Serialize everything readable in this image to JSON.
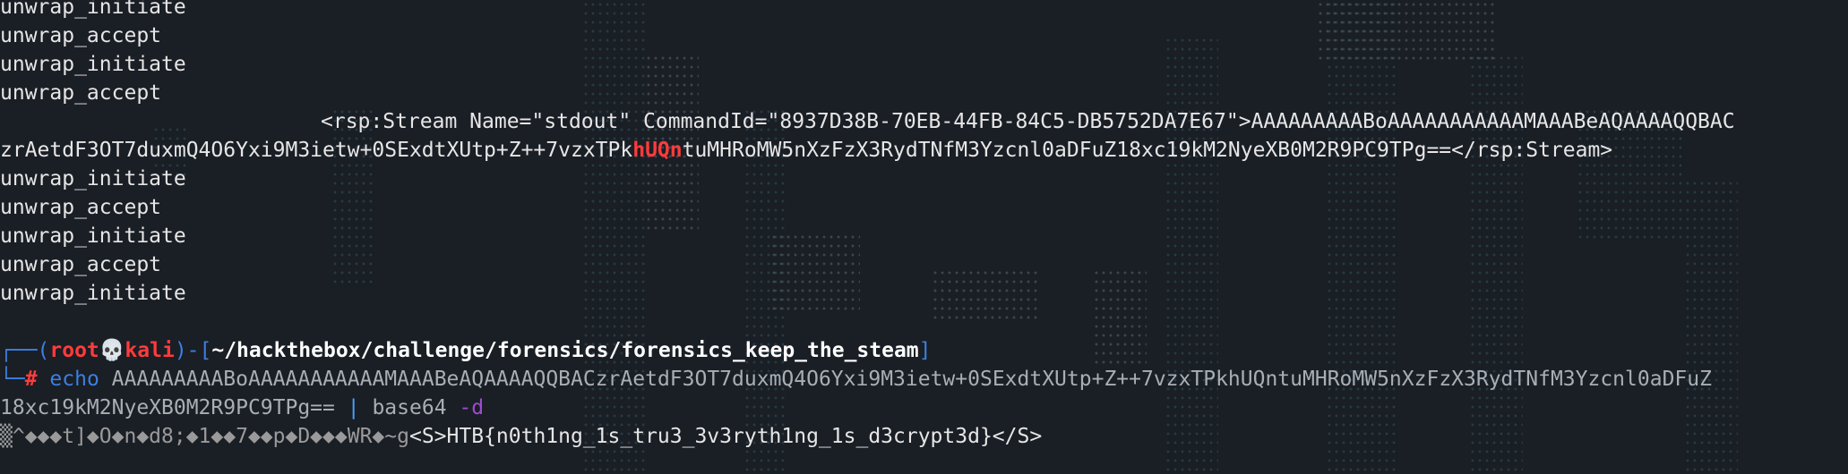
{
  "log_lines": {
    "l0": "unwrap_initiate",
    "l1": "unwrap_accept",
    "l2": "unwrap_initiate",
    "l3": "unwrap_accept",
    "stream_open": "<rsp:Stream Name=\"stdout\" CommandId=\"8937D38B-70EB-44FB-84C5-DB5752DA7E67\">AAAAAAAAABoAAAAAAAAAAAMAAABeAQAAAAQQBAC",
    "stream_cont_a": "zrAetdF3OT7duxmQ4O6Yxi9M3ietw+0SExdtXUtp+Z++7vzxTPk",
    "stream_highlight": "hUQn",
    "stream_cont_b": "tuMHRoMW5nXzFzX3RydTNfM3Yzcnl0aDFuZ18xc19kM2NyeXB0M2R9PC9TPg==</rsp:Stream>",
    "l6": "unwrap_initiate",
    "l7": "unwrap_accept",
    "l8": "unwrap_initiate",
    "l9": "unwrap_accept",
    "l10": "unwrap_initiate"
  },
  "prompt": {
    "box_top": "┌──(",
    "user": "root",
    "skull": "💀",
    "host": "kali",
    "mid": ")-[",
    "cwd": "~/hackthebox/challenge/forensics/forensics_keep_the_steam",
    "end": "]",
    "box_bottom": "└─",
    "hash": "#"
  },
  "command": {
    "echo": "echo",
    "arg": "AAAAAAAAABoAAAAAAAAAAAMAAABeAQAAAAQQBACzrAetdF3OT7duxmQ4O6Yxi9M3ietw+0SExdtXUtp+Z++7vzxTPkhUQntuMHRoMW5nXzFzX3RydTNfM3Yzcnl0aDFuZ",
    "arg_wrap": "18xc19kM2NyeXB0M2R9PC9TPg==",
    "pipe": "|",
    "base64": "base64",
    "flag": "-d"
  },
  "output": {
    "garbage": "▒^◆◆◆t]◆O◆n◆d8;◆1◆◆7◆◆p◆D◆◆◆WR◆~g",
    "result": "<S>HTB{n0th1ng_1s_tru3_3v3ryth1ng_1s_d3crypt3d}</S>"
  }
}
